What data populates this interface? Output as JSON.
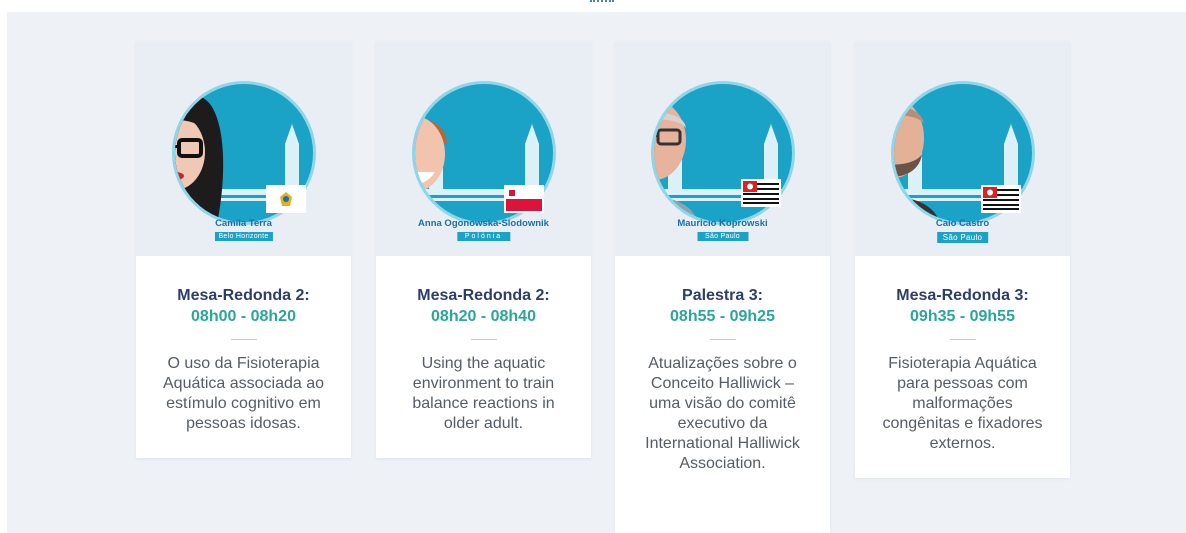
{
  "cards": [
    {
      "speaker": "Camila Terra",
      "city": "Belo Horizonte",
      "session": "Mesa-Redonda 2:",
      "time": "08h00 - 08h20",
      "description": "O uso da Fisioterapia Aquática associada ao estímulo cognitivo em pessoas idosas.",
      "flag": "belo-horizonte-flag"
    },
    {
      "speaker": "Anna Ogonowska-Slodownik",
      "city": "Polónia",
      "session": "Mesa-Redonda 2:",
      "time": "08h20 - 08h40",
      "description": "Using the aquatic environment to train balance reactions in older adult.",
      "flag": "poland-flag"
    },
    {
      "speaker": "Mauricio Koprowski",
      "city": "São Paulo",
      "session": "Palestra 3:",
      "time": "08h55 - 09h25",
      "description": "Atualizações sobre o Conceito Halliwick – uma visão do comitê executivo da International Halliwick Association.",
      "flag": "sao-paulo-flag"
    },
    {
      "speaker": "Caio Castro",
      "city": "São Paulo",
      "session": "Mesa-Redonda 3:",
      "time": "09h35 - 09h55",
      "description": "Fisioterapia Aquática para pessoas com malformações congênitas e fixadores externos.",
      "flag": "sao-paulo-flag"
    }
  ],
  "colors": {
    "accent": "#1aa3c6",
    "title": "#2c3e6b",
    "time": "#2aa79b",
    "background": "#eef2f7"
  }
}
